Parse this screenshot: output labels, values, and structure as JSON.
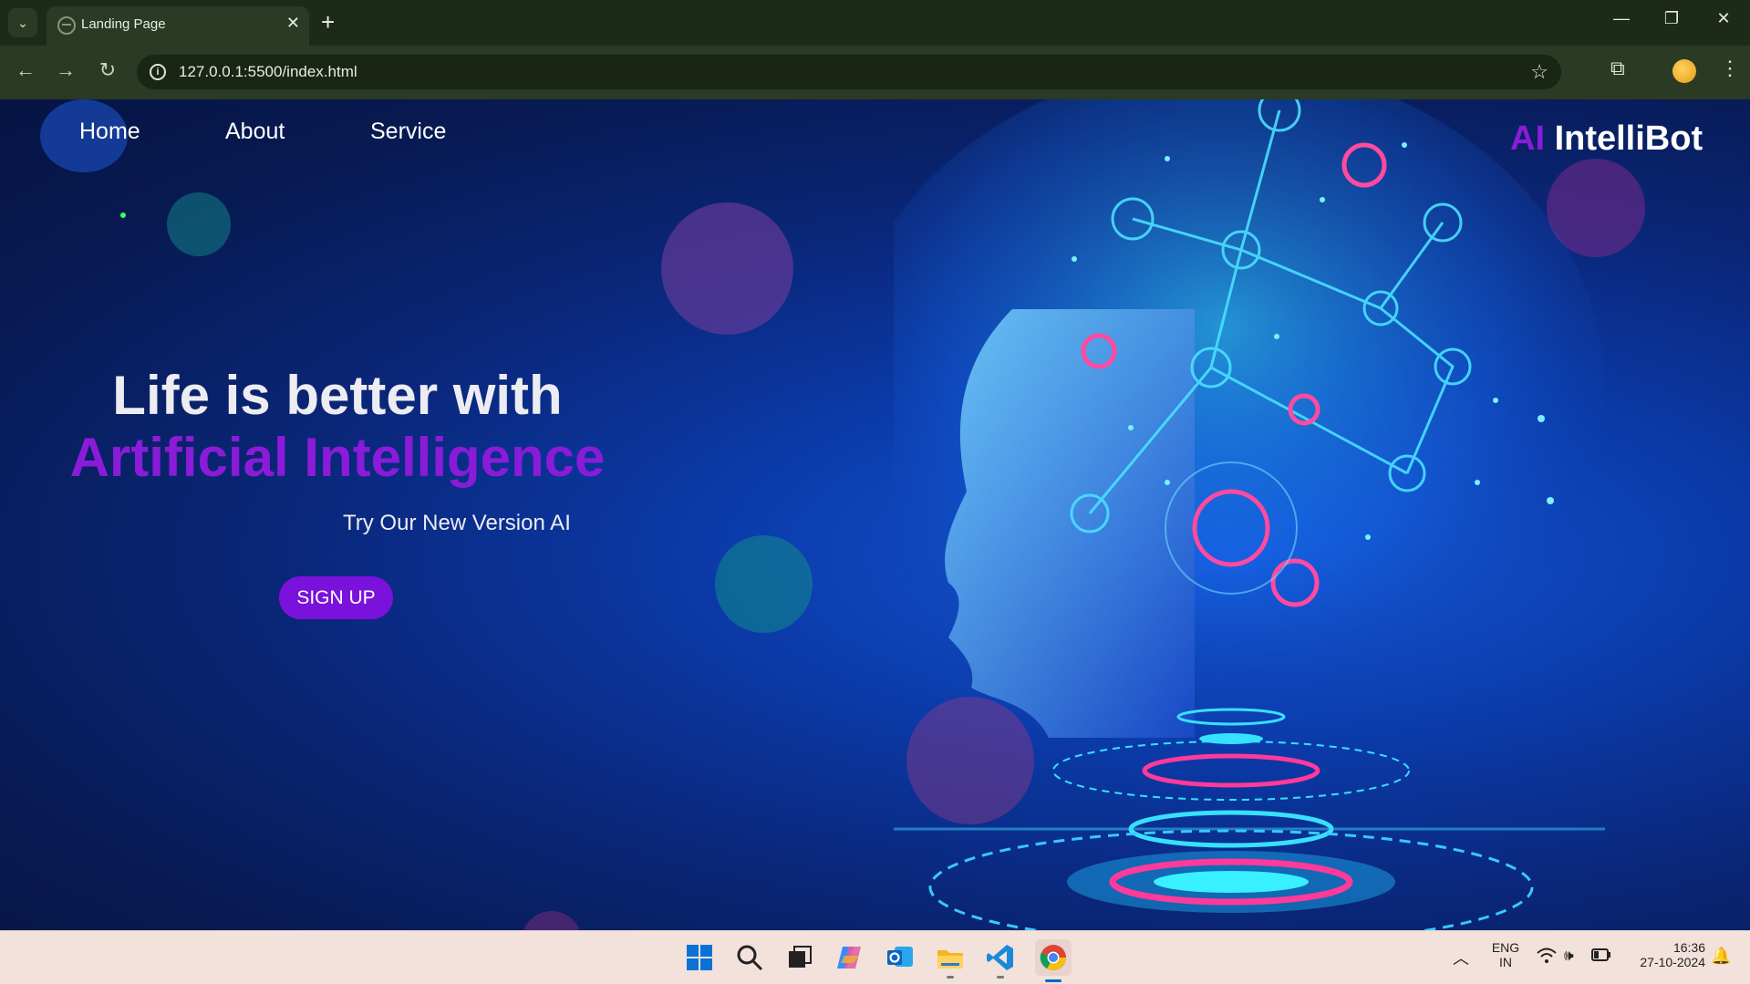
{
  "browser": {
    "tab_title": "Landing Page",
    "url": "127.0.0.1:5500/index.html",
    "icons": [
      "tab-search-icon",
      "close-icon",
      "plus-icon",
      "minimize-icon",
      "restore-icon",
      "back-icon",
      "forward-icon",
      "reload-icon",
      "info-icon",
      "star-icon",
      "extensions-icon",
      "profile-avatar",
      "more-vert-icon"
    ]
  },
  "nav": {
    "items": [
      {
        "label": "Home"
      },
      {
        "label": "About"
      },
      {
        "label": "Service"
      }
    ]
  },
  "brand": {
    "prefix": "AI",
    "name": "IntelliBot"
  },
  "hero": {
    "line1": "Life is better with",
    "line2": "Artificial Intelligence",
    "subtitle": "Try Our New Version AI",
    "cta": "SIGN UP"
  },
  "colors": {
    "accent": "#8a1bd8",
    "button": "#7a12dc",
    "background": "#0a2678"
  },
  "taskbar": {
    "apps": [
      "windows-start",
      "search",
      "task-view",
      "copilot",
      "outlook",
      "file-explorer",
      "vscode",
      "chrome"
    ],
    "tray": {
      "lang_top": "ENG",
      "lang_bottom": "IN",
      "time": "16:36",
      "date": "27-10-2024"
    }
  }
}
